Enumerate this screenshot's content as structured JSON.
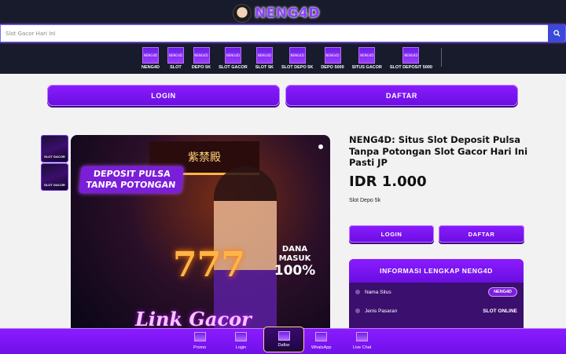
{
  "brand": {
    "logo_text": "NENG4D"
  },
  "search": {
    "placeholder": "Slot Gacor Hari Ini"
  },
  "nav": {
    "items": [
      {
        "label": "NENG4D",
        "icon": "neng4d-icon"
      },
      {
        "label": "SLOT",
        "icon": "neng4d-icon"
      },
      {
        "label": "DEPO 5K",
        "icon": "neng4d-icon"
      },
      {
        "label": "SLOT GACOR",
        "icon": "neng4d-icon"
      },
      {
        "label": "SLOT 5K",
        "icon": "neng4d-icon"
      },
      {
        "label": "SLOT DEPO 5K",
        "icon": "neng4d-icon"
      },
      {
        "label": "DEPO 5000",
        "icon": "neng4d-icon"
      },
      {
        "label": "SITUS GACOR",
        "icon": "neng4d-icon"
      },
      {
        "label": "SLOT DEPOSIT 5000",
        "icon": "neng4d-icon"
      }
    ]
  },
  "top_buttons": {
    "login": "LOGIN",
    "daftar": "DAFTAR"
  },
  "thumbs": [
    {
      "caption": "SLOT GACOR"
    },
    {
      "caption": "SLOT GACOR"
    }
  ],
  "hero": {
    "headline": "DEPOSIT PULSA TANPA POTONGAN",
    "badge_top": "DANA MASUK",
    "badge_pct": "100%",
    "sevens": "777",
    "tagline": "Link Gacor",
    "sign": "紫禁殿"
  },
  "product": {
    "title": "NENG4D: Situs Slot Deposit Pulsa Tanpa Potongan Slot Gacor Hari Ini Pasti JP",
    "price": "IDR 1.000",
    "subtitle": "Slot Depo 5k",
    "login": "LOGIN",
    "daftar": "DAFTAR"
  },
  "info": {
    "heading": "INFORMASI LENGKAP NENG4D",
    "rows": [
      {
        "label": "Nama Situs",
        "value": "NENG4D"
      },
      {
        "label": "Jenis Pasaran",
        "value": "SLOT ONLINE"
      }
    ]
  },
  "bottom_nav": {
    "items": [
      {
        "label": "Promo"
      },
      {
        "label": "Login"
      },
      {
        "label": "Daftar"
      },
      {
        "label": "WhatsApp"
      },
      {
        "label": "Live Chat"
      }
    ]
  },
  "colors": {
    "accent": "#8a1cff",
    "header_bg": "#171b2c",
    "page_bg": "#f2f2f2"
  }
}
